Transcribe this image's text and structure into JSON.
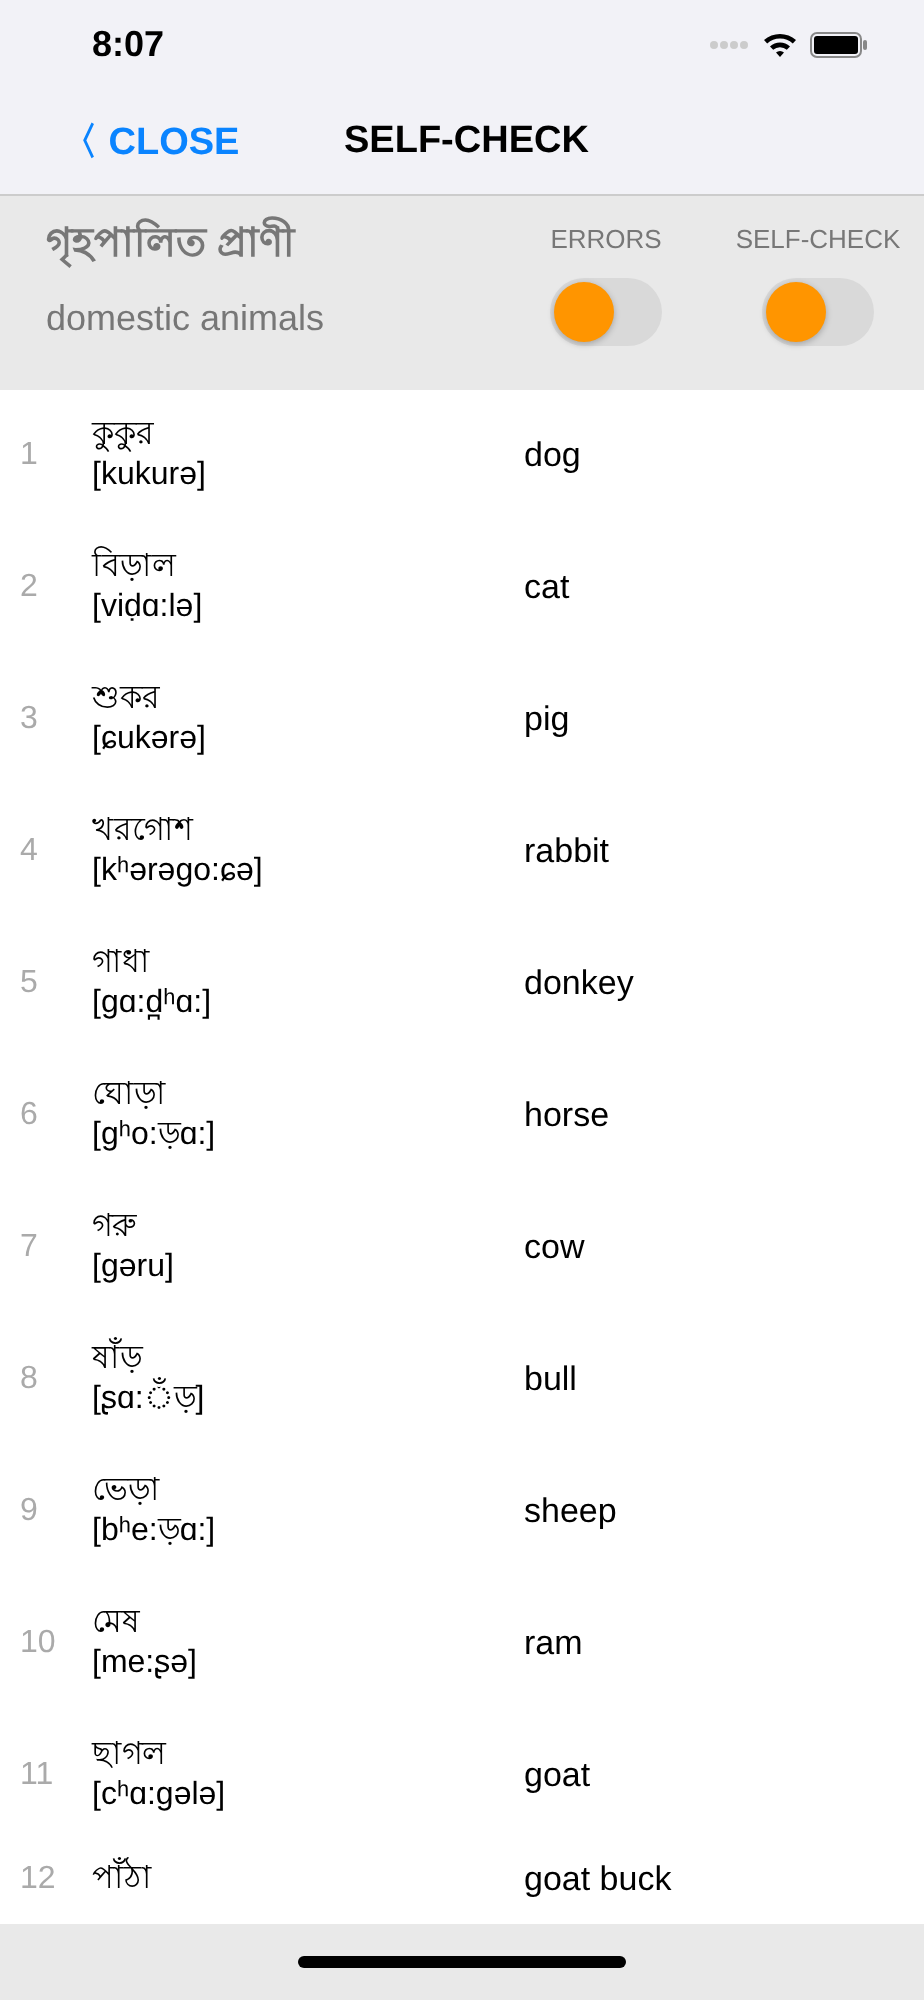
{
  "status_bar": {
    "time": "8:07"
  },
  "nav": {
    "back": "〈 CLOSE",
    "title": "SELF-CHECK"
  },
  "header": {
    "title": "গৃহপালিত প্রাণী",
    "subtitle": "domestic animals",
    "toggles": [
      {
        "label": "ERRORS",
        "on": false
      },
      {
        "label": "SELF-CHECK",
        "on": false
      }
    ]
  },
  "words": [
    {
      "number": "1",
      "word": "কুকুর",
      "transcription": "[kukurə]",
      "translation": "dog"
    },
    {
      "number": "2",
      "word": "বিড়াল",
      "transcription": "[viḍɑ:lə]",
      "translation": "cat"
    },
    {
      "number": "3",
      "word": "শুকর",
      "transcription": "[ɕukərə]",
      "translation": "pig"
    },
    {
      "number": "4",
      "word": "খরগোশ",
      "transcription": "[kʰərəgo:ɕə]",
      "translation": "rabbit"
    },
    {
      "number": "5",
      "word": "গাধা",
      "transcription": "[gɑ:d̪ʰɑ:]",
      "translation": "donkey"
    },
    {
      "number": "6",
      "word": "ঘোড়া",
      "transcription": "[gʰo:ড়ɑ:]",
      "translation": "horse"
    },
    {
      "number": "7",
      "word": "গরু",
      "transcription": "[gəru]",
      "translation": "cow"
    },
    {
      "number": "8",
      "word": "ষাঁড়",
      "transcription": "[ʂɑ:ঁড়]",
      "translation": "bull"
    },
    {
      "number": "9",
      "word": "ভেড়া",
      "transcription": "[bʰe:ড়ɑ:]",
      "translation": "sheep"
    },
    {
      "number": "10",
      "word": "মেষ",
      "transcription": "[me:ʂə]",
      "translation": "ram"
    },
    {
      "number": "11",
      "word": "ছাগল",
      "transcription": "[cʰɑ:gələ]",
      "translation": "goat"
    },
    {
      "number": "12",
      "word": "পাঁঠা",
      "translation": "goat buck"
    }
  ]
}
